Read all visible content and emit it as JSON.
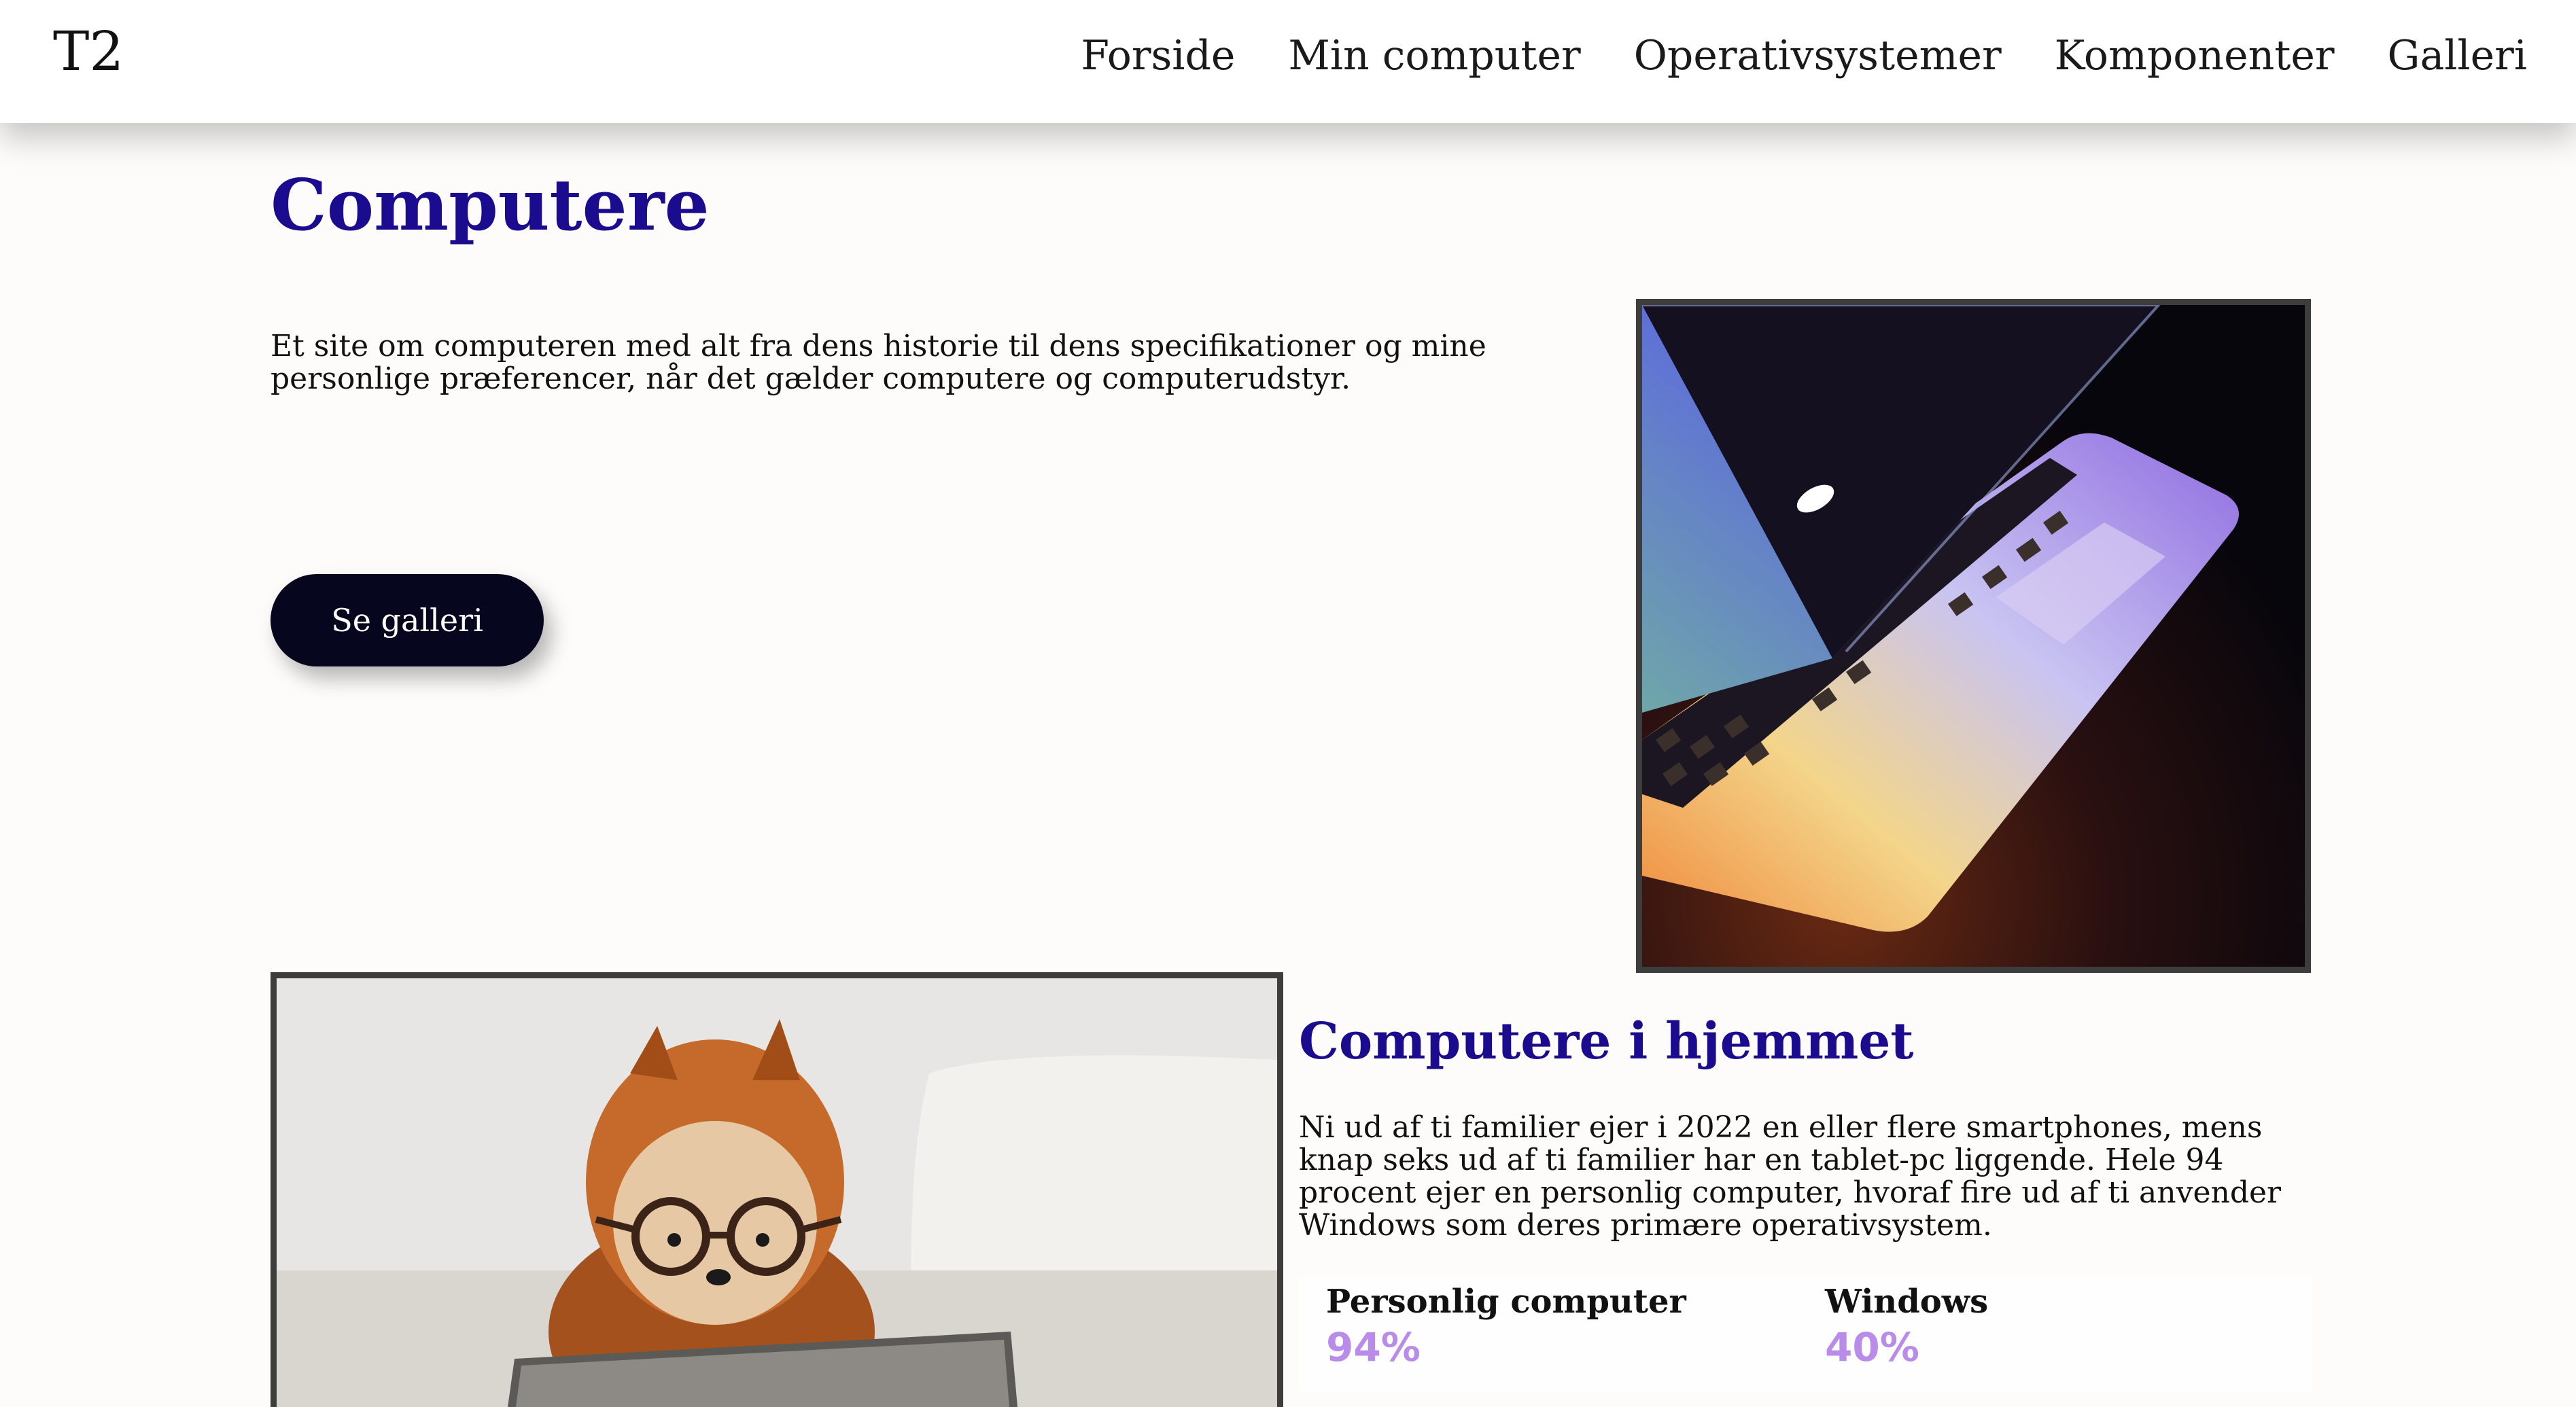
{
  "header": {
    "logo": "T2",
    "nav": [
      "Forside",
      "Min computer",
      "Operativsystemer",
      "Komponenter",
      "Galleri"
    ]
  },
  "hero": {
    "title": "Computere",
    "description": "Et site om computeren med alt fra dens historie til dens specifikationer og mine personlige præferencer, når det gælder computere og computerudstyr.",
    "button_label": "Se galleri"
  },
  "home_section": {
    "title": "Computere i hjemmet",
    "text": "Ni ud af ti familier ejer i 2022 en eller flere smartphones, mens knap seks ud af ti familier har en tablet-pc liggende. Hele 94 procent ejer en personlig computer, hvoraf fire ud af ti anvender Windows som deres primære operativsystem.",
    "stats": [
      {
        "label": "Personlig computer",
        "value": "94%"
      },
      {
        "label": "Windows",
        "value": "40%"
      }
    ]
  },
  "colors": {
    "heading": "#1b0b8f",
    "button_bg": "#06061e",
    "stat_value": "#b98cea",
    "page_bg": "#fdfcfa"
  }
}
